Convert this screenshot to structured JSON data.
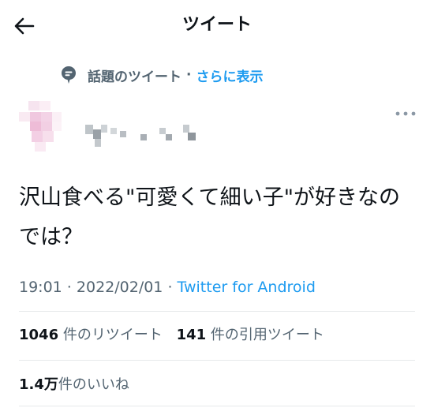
{
  "header": {
    "title": "ツイート",
    "back_icon": "arrow-left-icon"
  },
  "topic": {
    "icon": "topic-bubble-icon",
    "label": "話題のツイート",
    "separator": "·",
    "link": "さらに表示"
  },
  "author": {
    "avatar_icon": "blurred-avatar",
    "more_icon": "more-horizontal-icon"
  },
  "tweet": {
    "text": "沢山食べる\"可愛くて細い子\"が好きなのでは？"
  },
  "meta": {
    "time": "19:01",
    "separator1": " · ",
    "date": "2022/02/01",
    "separator2": " · ",
    "source": "Twitter for Android"
  },
  "stats": {
    "retweets_count": "1046",
    "retweets_label": "件のリツイート",
    "quotes_count": "141",
    "quotes_label": "件の引用ツイート",
    "likes_count": "1.4万",
    "likes_label": "件のいいね"
  },
  "colors": {
    "accent": "#1d9bf0",
    "secondary_text": "#536471",
    "divider": "#e7e9ea"
  }
}
